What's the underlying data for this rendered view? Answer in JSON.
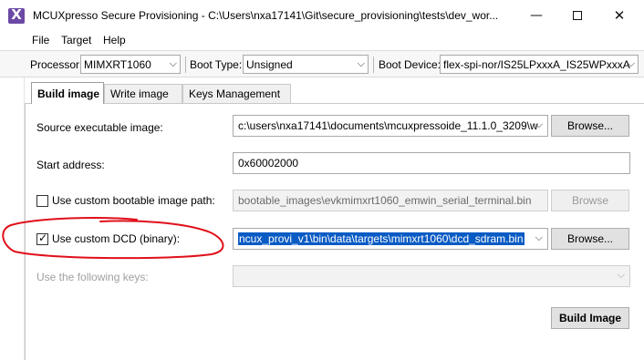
{
  "window": {
    "title": "MCUXpresso Secure Provisioning - C:\\Users\\nxa17141\\Git\\secure_provisioning\\tests\\dev_wor...",
    "app_icon_glyph": "X",
    "minimize_glyph": "—",
    "close_glyph": "✕"
  },
  "menu": [
    "File",
    "Target",
    "Help"
  ],
  "toolbar": {
    "processor_label": "Processor:",
    "processor_value": "MIMXRT1060",
    "boot_type_label": "Boot Type:",
    "boot_type_value": "Unsigned",
    "boot_device_label": "Boot Device:",
    "boot_device_value": "flex-spi-nor/IS25LPxxxA_IS25WPxxxA"
  },
  "tabs": [
    "Build image",
    "Write image",
    "Keys Management"
  ],
  "form": {
    "source_label": "Source executable image:",
    "source_value": "c:\\users\\nxa17141\\documents\\mcuxpressoide_11.1.0_3209\\w",
    "source_browse": "Browse...",
    "start_label": "Start address:",
    "start_value": "0x60002000",
    "bootable_label": "Use custom bootable image path:",
    "bootable_value": "bootable_images\\evkmimxrt1060_emwin_serial_terminal.bin",
    "bootable_browse": "Browse",
    "dcd_label": "Use custom DCD (binary):",
    "dcd_value": "ncux_provi_v1\\bin\\data\\targets\\mimxrt1060\\dcd_sdram.bin",
    "dcd_browse": "Browse...",
    "keys_label": "Use the following keys:",
    "keys_value": "",
    "build_button": "Build Image"
  },
  "colors": {
    "accent_selection": "#0a5bc4",
    "annotation_red": "#e0101a",
    "app_icon": "#6b4aa5"
  },
  "icons": {
    "chevron": "chevron-down-icon",
    "check": "check-icon"
  },
  "glyphs": {
    "chevron": "⌵",
    "check": "✓"
  }
}
